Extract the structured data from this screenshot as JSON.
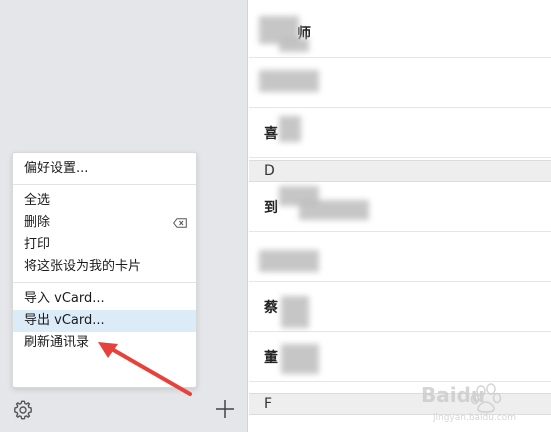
{
  "menu": {
    "items": [
      {
        "label": "偏好设置..."
      },
      {
        "label": "全选"
      },
      {
        "label": "删除"
      },
      {
        "label": "打印"
      },
      {
        "label": "将这张设为我的卡片"
      },
      {
        "label": "导入 vCard..."
      },
      {
        "label": "导出 vCard..."
      },
      {
        "label": "刷新通讯录"
      }
    ],
    "highlighted": "导出 vCard...",
    "highlight_color": "#dcebf8"
  },
  "contacts": {
    "rows": [
      {
        "visible_text": "师"
      },
      {
        "visible_text": ""
      },
      {
        "visible_text": "喜"
      },
      {
        "visible_text": "到"
      },
      {
        "visible_text": ""
      },
      {
        "visible_text": "蔡"
      },
      {
        "visible_text": "董"
      }
    ],
    "sections": [
      {
        "letter": "D"
      },
      {
        "letter": "F"
      }
    ]
  },
  "icons": {
    "settings": "gear-icon",
    "add": "plus-icon",
    "delete_key": "delete-key-icon",
    "annotation": "red-arrow-icon"
  },
  "watermark": {
    "brand": "Baidu",
    "sub": "jingyan.baidu.com"
  },
  "colors": {
    "sidebar": "#e4e6ea",
    "arrow": "#e8413b"
  }
}
